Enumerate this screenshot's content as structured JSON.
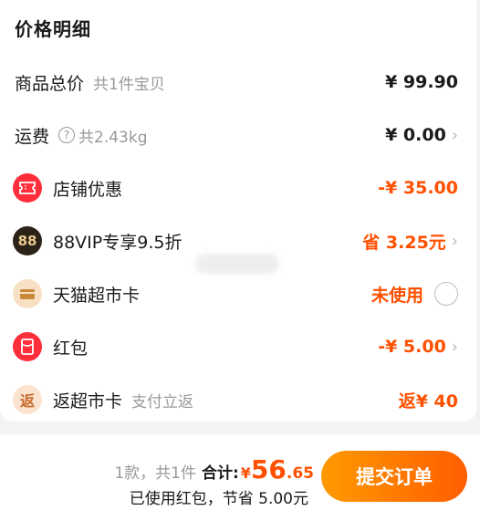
{
  "header": {
    "title": "价格明细"
  },
  "rows": {
    "goods": {
      "label": "商品总价",
      "sub": "共1件宝贝",
      "value": "¥ 99.90"
    },
    "shipping": {
      "label": "运费",
      "sub": "共2.43kg",
      "value": "¥ 0.00"
    },
    "shop_discount": {
      "label": "店铺优惠",
      "value": "-¥ 35.00"
    },
    "vip": {
      "icon_text": "88",
      "label": "88VIP专享9.5折",
      "value": "省 3.25元"
    },
    "tmall_card": {
      "label": "天猫超市卡",
      "value": "未使用"
    },
    "red_packet": {
      "label": "红包",
      "value": "-¥ 5.00"
    },
    "rebate_card": {
      "icon_text": "返",
      "label": "返超市卡",
      "sub": "支付立返",
      "value": "返¥ 40"
    }
  },
  "footer": {
    "count": "1款，共1件",
    "total_label": "合计:",
    "currency": "¥",
    "total_int": "56",
    "total_dec": ".65",
    "savings": "已使用红包，节省 5.00元",
    "submit": "提交订单"
  },
  "colors": {
    "accent": "#ff5000",
    "submit_start": "#ff9a00",
    "submit_end": "#ff5e00"
  }
}
